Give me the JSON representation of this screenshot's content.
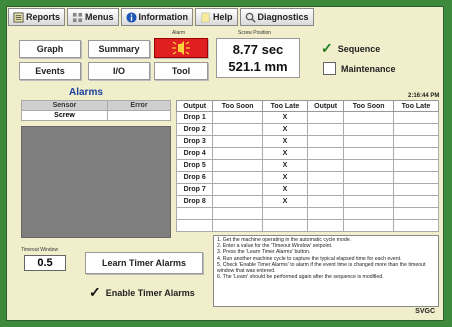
{
  "menu": {
    "reports": "Reports",
    "menus": "Menus",
    "information": "Information",
    "help": "Help",
    "diagnostics": "Diagnostics"
  },
  "buttons": {
    "graph": "Graph",
    "summary": "Summary",
    "events": "Events",
    "io": "I/O",
    "tool": "Tool"
  },
  "alarm_label": "Alarm",
  "screw_position": {
    "label": "Screw Position",
    "time": "8.77 sec",
    "distance": "521.1 mm"
  },
  "checkboxes": {
    "sequence": {
      "label": "Sequence",
      "checked": true
    },
    "maintenance": {
      "label": "Maintenance",
      "checked": false
    }
  },
  "alarms": {
    "title": "Alarms",
    "columns": [
      "Sensor",
      "Error"
    ],
    "rows": [
      [
        "Screw",
        ""
      ]
    ]
  },
  "clock": "2:16:44 PM",
  "drop_table": {
    "columns": [
      "Output",
      "Too Soon",
      "Too Late",
      "Output",
      "Too Soon",
      "Too Late"
    ],
    "rows": [
      [
        "Drop 1",
        "",
        "X",
        "",
        "",
        ""
      ],
      [
        "Drop 2",
        "",
        "X",
        "",
        "",
        ""
      ],
      [
        "Drop 3",
        "",
        "X",
        "",
        "",
        ""
      ],
      [
        "Drop 4",
        "",
        "X",
        "",
        "",
        ""
      ],
      [
        "Drop 5",
        "",
        "X",
        "",
        "",
        ""
      ],
      [
        "Drop 6",
        "",
        "X",
        "",
        "",
        ""
      ],
      [
        "Drop 7",
        "",
        "X",
        "",
        "",
        ""
      ],
      [
        "Drop 8",
        "",
        "X",
        "",
        "",
        ""
      ],
      [
        "",
        "",
        "",
        "",
        "",
        ""
      ],
      [
        "",
        "",
        "",
        "",
        "",
        ""
      ]
    ]
  },
  "timeout": {
    "label": "Timeout Window",
    "value": "0.5"
  },
  "learn_button": "Learn Timer Alarms",
  "enable_timer": {
    "label": "Enable Timer Alarms",
    "checked": true
  },
  "instructions": [
    "1. Get the machine operating in the automatic cycle mode.",
    "2. Enter a value for the 'Timeout Window' setpoint.",
    "3. Press the 'Learn Timer Alarms' button.",
    "4. Run another machine cycle to capture the typical elapsed time for each event.",
    "5. Check 'Enable Timer Alarms' to alarm if the event time is changed more than the timeout window that was entered.",
    "6. The 'Learn' should be performed again after the sequence is modified."
  ],
  "footer": "SVGC",
  "colors": {
    "background": "#3d8a3d",
    "panel": "#f1efcb",
    "alarm_button": "#e02020",
    "alarms_title": "#1a3fa0"
  }
}
